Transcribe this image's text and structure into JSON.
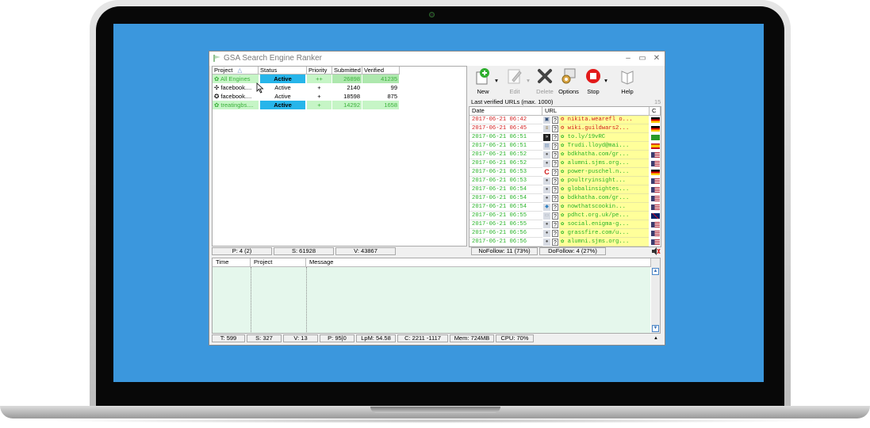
{
  "app": {
    "title": "GSA Search Engine Ranker",
    "window_buttons": [
      "–",
      "▭",
      "✕"
    ]
  },
  "projects": {
    "columns": [
      "Project",
      "Status",
      "Priority",
      "Submitted",
      "Verified"
    ],
    "rows": [
      {
        "icon": "✿",
        "project": "All Engines",
        "status": "Active",
        "priority": "++",
        "submitted": "26898",
        "verified": "41235",
        "style": "green"
      },
      {
        "icon": "✣",
        "project": "facebook....",
        "status": "Active",
        "priority": "+",
        "submitted": "2140",
        "verified": "99",
        "style": "white"
      },
      {
        "icon": "✪",
        "project": "facebook....",
        "status": "Active",
        "priority": "+",
        "submitted": "18598",
        "verified": "875",
        "style": "white"
      },
      {
        "icon": "✿",
        "project": "treatingbs....",
        "status": "Active",
        "priority": "+",
        "submitted": "14292",
        "verified": "1658",
        "style": "green"
      }
    ],
    "status_bar": {
      "p": "P: 4 (2)",
      "s": "S: 61928",
      "v": "V: 43867"
    }
  },
  "toolbar": {
    "new": "New",
    "edit": "Edit",
    "delete": "Delete",
    "options": "Options",
    "stop": "Stop",
    "help": "Help"
  },
  "verified_urls": {
    "title": "Last verified URLs (max. 1000)",
    "count": "15",
    "columns": [
      "Date",
      "URL",
      "C"
    ],
    "rows": [
      {
        "date": "2017-06-21 06:42",
        "url": "nikita.wearefl o...",
        "color": "red",
        "icon": "film-icon",
        "flag": "de"
      },
      {
        "date": "2017-06-21 06:45",
        "url": "wiki.guildwars2...",
        "color": "red",
        "icon": "book-icon",
        "flag": "de"
      },
      {
        "date": "2017-06-21 06:51",
        "url": "to.ly/19vRC",
        "color": "green",
        "icon": "redirect-icon",
        "flag": "br"
      },
      {
        "date": "2017-06-21 06:51",
        "url": "Trudi.lloyd@mai...",
        "color": "green",
        "icon": "forum-icon",
        "flag": "es"
      },
      {
        "date": "2017-06-21 06:52",
        "url": "bdkhatha.com/gr...",
        "color": "green",
        "icon": "user-icon",
        "flag": "us"
      },
      {
        "date": "2017-06-21 06:52",
        "url": "alumni.sjms.org...",
        "color": "green",
        "icon": "user-icon",
        "flag": "us"
      },
      {
        "date": "2017-06-21 06:53",
        "url": "power-puschel.n...",
        "color": "green",
        "icon": "c-icon",
        "flag": "de"
      },
      {
        "date": "2017-06-21 06:53",
        "url": "poultryinsight...",
        "color": "green",
        "icon": "user-icon",
        "flag": "us"
      },
      {
        "date": "2017-06-21 06:54",
        "url": "globalinsightes...",
        "color": "green",
        "icon": "user-icon",
        "flag": "us"
      },
      {
        "date": "2017-06-21 06:54",
        "url": "bdkhatha.com/gr...",
        "color": "green",
        "icon": "user-icon",
        "flag": "us"
      },
      {
        "date": "2017-06-21 06:54",
        "url": "nowthatscookin...",
        "color": "green",
        "icon": "drupal-icon",
        "flag": "us"
      },
      {
        "date": "2017-06-21 06:55",
        "url": "pdhct.org.uk/pe...",
        "color": "green",
        "icon": "comment-icon",
        "flag": "gb"
      },
      {
        "date": "2017-06-21 06:55",
        "url": "social.enigma-g...",
        "color": "green",
        "icon": "user-icon",
        "flag": "us"
      },
      {
        "date": "2017-06-21 06:56",
        "url": "grassfire.com/u...",
        "color": "green",
        "icon": "user-icon",
        "flag": "us"
      },
      {
        "date": "2017-06-21 06:56",
        "url": "alumni.sjms.org...",
        "color": "green",
        "icon": "user-icon",
        "flag": "us"
      }
    ],
    "status_bar": {
      "nofollow": "NoFollow: 11 (73%)",
      "dofollow": "DoFollow: 4 (27%)"
    }
  },
  "log": {
    "columns": [
      "Time",
      "Project",
      "Message"
    ]
  },
  "bottom_status": {
    "t": "T: 599",
    "s": "S: 327",
    "v": "V: 13",
    "p": "P: 95|0",
    "lpm": "LpM: 54.58",
    "c": "C: 2211 -1117",
    "mem": "Mem: 724MB",
    "cpu": "CPU: 70%"
  },
  "colors": {
    "screen": "#3b97dd",
    "active_status": "#27b5ea",
    "row_green": "#c6f5c6",
    "url_highlight": "#ffff9a",
    "log_bg": "#e5f7ec"
  }
}
